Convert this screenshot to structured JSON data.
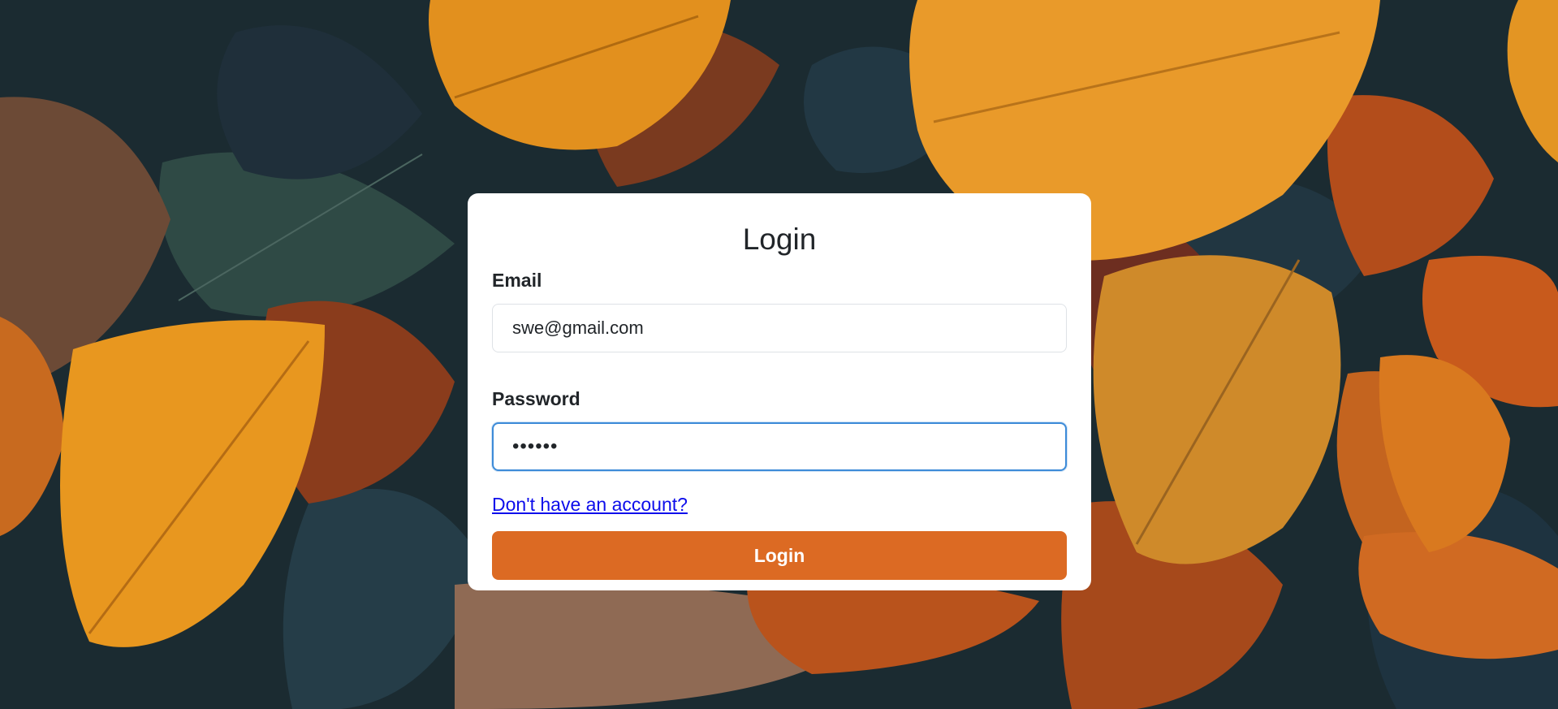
{
  "form": {
    "title": "Login",
    "email_label": "Email",
    "email_value": "swe@gmail.com",
    "password_label": "Password",
    "password_value": "••••••",
    "signup_link": "Don't have an account?",
    "submit_label": "Login"
  },
  "colors": {
    "accent": "#dc6a23",
    "link": "#0d0deb",
    "focus_border": "#3d8bd8",
    "card_background": "#ffffff"
  },
  "background": {
    "description_icon": "autumn-leaves"
  }
}
